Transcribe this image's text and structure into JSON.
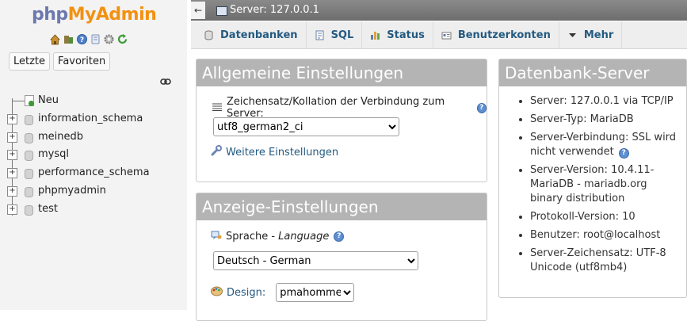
{
  "nav": {
    "logo_php": "php",
    "logo_myadmin": "MyAdmin",
    "icons": [
      "home-icon",
      "db-icon",
      "help-icon",
      "docs-icon",
      "settings-icon",
      "reload-icon"
    ],
    "buttons": {
      "recent": "Letzte",
      "favorites": "Favoriten"
    },
    "tree": [
      {
        "label": "Neu",
        "kind": "new"
      },
      {
        "label": "information_schema",
        "kind": "db"
      },
      {
        "label": "meinedb",
        "kind": "db"
      },
      {
        "label": "mysql",
        "kind": "db"
      },
      {
        "label": "performance_schema",
        "kind": "db"
      },
      {
        "label": "phpmyadmin",
        "kind": "db"
      },
      {
        "label": "test",
        "kind": "db"
      }
    ]
  },
  "serverbar": {
    "collapse": "←",
    "label": "Server: 127.0.0.1"
  },
  "tabs": [
    {
      "label": "Datenbanken",
      "icon": "databases-icon"
    },
    {
      "label": "SQL",
      "icon": "sql-icon"
    },
    {
      "label": "Status",
      "icon": "status-icon"
    },
    {
      "label": "Benutzerkonten",
      "icon": "users-icon"
    },
    {
      "label": "Mehr",
      "icon": "dropdown-arrow-icon"
    }
  ],
  "general_settings": {
    "title": "Allgemeine Einstellungen",
    "collation_label": "Zeichensatz/Kollation der Verbindung zum Server:",
    "collation_value": "utf8_german2_ci",
    "more_settings": "Weitere Einstellungen"
  },
  "display_settings": {
    "title": "Anzeige-Einstellungen",
    "language_label": "Sprache",
    "language_dash": " - ",
    "language_label_en": "Language",
    "language_value": "Deutsch - German",
    "design_label": "Design:",
    "design_value": "pmahomme"
  },
  "db_server": {
    "title": "Datenbank-Server",
    "items": [
      "Server: 127.0.0.1 via TCP/IP",
      "Server-Typ: MariaDB",
      "Server-Verbindung: SSL wird nicht verwendet",
      "Server-Version: 10.4.11-MariaDB - mariadb.org binary distribution",
      "Protokoll-Version: 10",
      "Benutzer: root@localhost",
      "Server-Zeichensatz: UTF-8 Unicode (utf8mb4)"
    ]
  },
  "colors": {
    "tab_text": "#235a81",
    "panel_header": "#b4b4b4",
    "logo_php": "#6c78af",
    "logo_myadmin": "#f29111"
  }
}
